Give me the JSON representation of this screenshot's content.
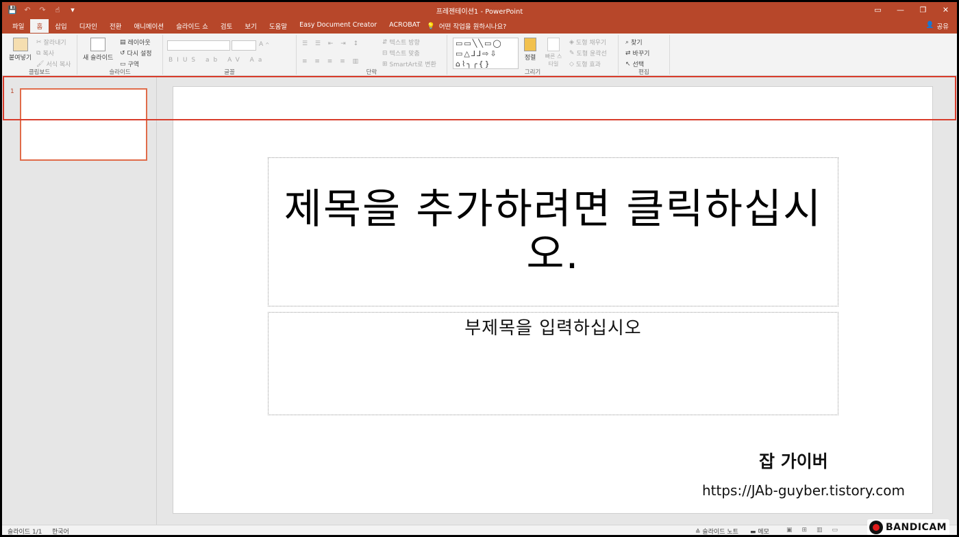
{
  "window": {
    "title": "프레젠테이션1  -  PowerPoint",
    "controls": [
      "▭",
      "—",
      "❐",
      "✕"
    ]
  },
  "qat": {
    "save_icon": "💾",
    "undo_icon": "↶",
    "redo_icon": "↷",
    "touch_icon": "☝",
    "customize_icon": "▾"
  },
  "tabs": [
    "파일",
    "홈",
    "삽입",
    "디자인",
    "전환",
    "애니메이션",
    "슬라이드 쇼",
    "검토",
    "보기",
    "도움말",
    "Easy Document Creator",
    "ACROBAT"
  ],
  "tell_me": "어떤 작업을 원하시나요?",
  "share": "공유",
  "ribbon": {
    "clipboard": {
      "label": "클립보드",
      "paste": "붙여넣기",
      "cut": "잘라내기",
      "copy": "복사",
      "format_painter": "서식 복사"
    },
    "slides": {
      "label": "슬라이드",
      "new_slide": "새 슬라이드",
      "layout": "레이아웃",
      "reset": "다시 설정",
      "section": "구역"
    },
    "font": {
      "label": "글꼴"
    },
    "paragraph": {
      "label": "단락",
      "text_direction": "텍스트 방향",
      "align_text": "텍스트 맞춤",
      "smartart": "SmartArt로 변환"
    },
    "drawing": {
      "label": "그리기",
      "shapes_preview": "▭▭╲╲▭◯ ▭△⅃⅃⇨⇩ ⌂⌇╮╭{}",
      "arrange": "정렬",
      "quick_styles": "빠른 스타일",
      "shape_fill": "도형 채우기",
      "shape_outline": "도형 윤곽선",
      "shape_effects": "도형 효과"
    },
    "editing": {
      "label": "편집",
      "find": "찾기",
      "replace": "바꾸기",
      "select": "선택"
    }
  },
  "thumbnail": {
    "number": "1"
  },
  "slide": {
    "title": "제목을 추가하려면 클릭하십시오.",
    "subtitle": "부제목을 입력하십시오",
    "author": "잡 가이버",
    "url": "https://JAb-guyber.tistory.com"
  },
  "statusbar": {
    "slide_count": "슬라이드 1/1",
    "language": "한국어",
    "notes": "슬라이드 노트",
    "comments": "메모"
  },
  "bandicam": "BANDICAM",
  "colors": {
    "accent": "#b7472a",
    "highlight": "#d83b2a",
    "thumb_border": "#e06b49"
  }
}
